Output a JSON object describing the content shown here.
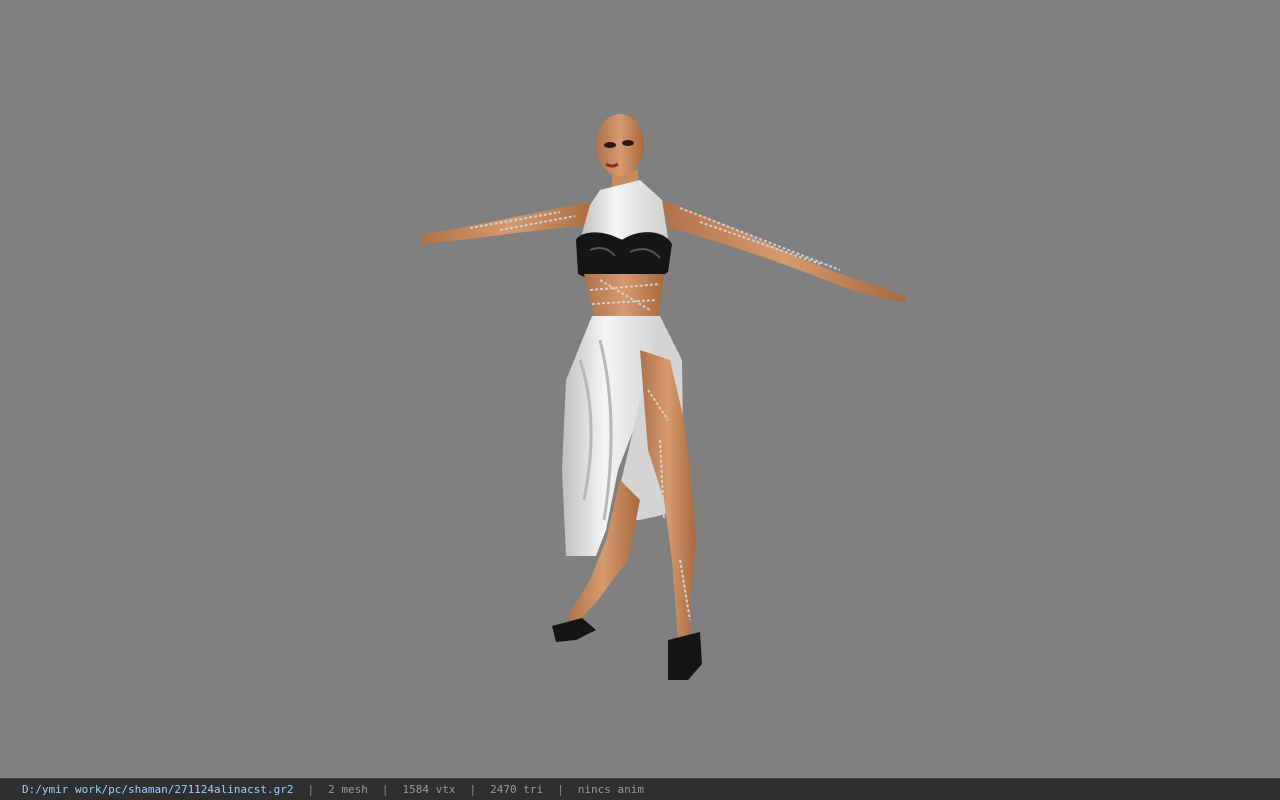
{
  "viewport": {
    "background": "#808080",
    "model": "character-model"
  },
  "status": {
    "file_path": "D:/ymir work/pc/shaman/271124alinacst.gr2",
    "separator": "|",
    "mesh_count": "2 mesh",
    "vertex_count": "1584 vtx",
    "triangle_count": "2470 tri",
    "animation": "nincs anim"
  },
  "colors": {
    "statusbar_bg": "#2f2f2f",
    "path_text": "#9ecfff",
    "info_text": "#9a9a9a",
    "skin": "#c98b5e",
    "dress": "#e8e8e8",
    "top": "#1a1a1a"
  }
}
